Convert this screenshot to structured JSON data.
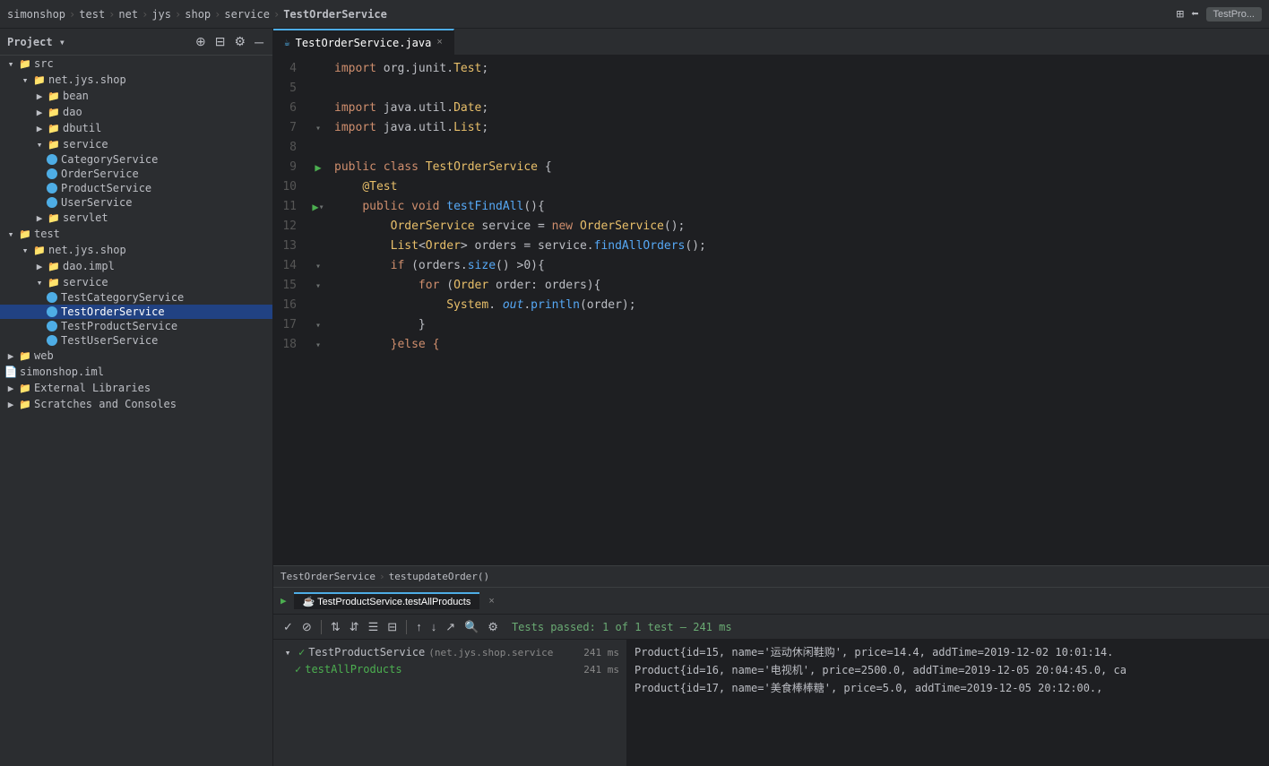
{
  "titleBar": {
    "breadcrumbs": [
      "simonshop",
      "test",
      "net",
      "jys",
      "shop",
      "service",
      "TestOrderService"
    ],
    "rightBtn": "TestPro..."
  },
  "sidebar": {
    "title": "Project",
    "tree": [
      {
        "id": "src",
        "label": "src",
        "type": "folder",
        "indent": 0,
        "expanded": true
      },
      {
        "id": "net.jys.shop",
        "label": "net.jys.shop",
        "type": "folder",
        "indent": 1,
        "expanded": true
      },
      {
        "id": "bean",
        "label": "bean",
        "type": "folder",
        "indent": 2,
        "expanded": false
      },
      {
        "id": "dao",
        "label": "dao",
        "type": "folder",
        "indent": 2,
        "expanded": false
      },
      {
        "id": "dbutil",
        "label": "dbutil",
        "type": "folder",
        "indent": 2,
        "expanded": false
      },
      {
        "id": "service",
        "label": "service",
        "type": "folder",
        "indent": 2,
        "expanded": true
      },
      {
        "id": "CategoryService",
        "label": "CategoryService",
        "type": "java",
        "indent": 3
      },
      {
        "id": "OrderService",
        "label": "OrderService",
        "type": "java",
        "indent": 3
      },
      {
        "id": "ProductService",
        "label": "ProductService",
        "type": "java",
        "indent": 3
      },
      {
        "id": "UserService",
        "label": "UserService",
        "type": "java",
        "indent": 3
      },
      {
        "id": "servlet",
        "label": "servlet",
        "type": "folder",
        "indent": 2,
        "expanded": false
      },
      {
        "id": "test",
        "label": "test",
        "type": "folder",
        "indent": 0,
        "expanded": true
      },
      {
        "id": "net.jys.shop2",
        "label": "net.jys.shop",
        "type": "folder",
        "indent": 1,
        "expanded": true
      },
      {
        "id": "dao.impl",
        "label": "dao.impl",
        "type": "folder",
        "indent": 2,
        "expanded": false
      },
      {
        "id": "service2",
        "label": "service",
        "type": "folder",
        "indent": 2,
        "expanded": true
      },
      {
        "id": "TestCategoryService",
        "label": "TestCategoryService",
        "type": "java",
        "indent": 3
      },
      {
        "id": "TestOrderService",
        "label": "TestOrderService",
        "type": "java",
        "indent": 3,
        "selected": true
      },
      {
        "id": "TestProductService",
        "label": "TestProductService",
        "type": "java",
        "indent": 3
      },
      {
        "id": "TestUserService",
        "label": "TestUserService",
        "type": "java",
        "indent": 3
      },
      {
        "id": "web",
        "label": "web",
        "type": "folder",
        "indent": 0,
        "expanded": false
      },
      {
        "id": "simonshop.iml",
        "label": "simonshop.iml",
        "type": "iml",
        "indent": 0
      },
      {
        "id": "External Libraries",
        "label": "External Libraries",
        "type": "folder",
        "indent": 0,
        "expanded": false
      },
      {
        "id": "Scratches and Consoles",
        "label": "Scratches and Consoles",
        "type": "folder",
        "indent": 0,
        "expanded": false
      }
    ]
  },
  "editor": {
    "tab": "TestOrderService.java",
    "lines": [
      {
        "num": 4,
        "tokens": [
          {
            "t": "import ",
            "c": "import-kw"
          },
          {
            "t": "org.",
            "c": "plain"
          },
          {
            "t": "junit.",
            "c": "plain"
          },
          {
            "t": "Test",
            "c": "import-cls"
          },
          {
            "t": ";",
            "c": "plain"
          }
        ]
      },
      {
        "num": 5,
        "tokens": []
      },
      {
        "num": 6,
        "tokens": [
          {
            "t": "import ",
            "c": "import-kw"
          },
          {
            "t": "java.",
            "c": "plain"
          },
          {
            "t": "util.",
            "c": "plain"
          },
          {
            "t": "Date",
            "c": "import-cls"
          },
          {
            "t": ";",
            "c": "plain"
          }
        ]
      },
      {
        "num": 7,
        "tokens": [
          {
            "t": "import ",
            "c": "import-kw"
          },
          {
            "t": "java.",
            "c": "plain"
          },
          {
            "t": "util.",
            "c": "plain"
          },
          {
            "t": "List",
            "c": "import-cls"
          },
          {
            "t": ";",
            "c": "plain"
          }
        ],
        "fold": true
      },
      {
        "num": 8,
        "tokens": []
      },
      {
        "num": 9,
        "tokens": [
          {
            "t": "public ",
            "c": "kw"
          },
          {
            "t": "class ",
            "c": "kw"
          },
          {
            "t": "TestOrderService",
            "c": "cls"
          },
          {
            "t": " {",
            "c": "plain"
          }
        ],
        "run": true
      },
      {
        "num": 10,
        "tokens": [
          {
            "t": "    ",
            "c": "plain"
          },
          {
            "t": "@Test",
            "c": "ann"
          }
        ]
      },
      {
        "num": 11,
        "tokens": [
          {
            "t": "    ",
            "c": "plain"
          },
          {
            "t": "public ",
            "c": "kw"
          },
          {
            "t": "void ",
            "c": "kw"
          },
          {
            "t": "testFindAll",
            "c": "method"
          },
          {
            "t": "(){",
            "c": "plain"
          }
        ],
        "run": true,
        "fold": true
      },
      {
        "num": 12,
        "tokens": [
          {
            "t": "        ",
            "c": "plain"
          },
          {
            "t": "OrderService",
            "c": "cls"
          },
          {
            "t": " service = ",
            "c": "plain"
          },
          {
            "t": "new ",
            "c": "kw"
          },
          {
            "t": "OrderService",
            "c": "cls"
          },
          {
            "t": "();",
            "c": "plain"
          }
        ]
      },
      {
        "num": 13,
        "tokens": [
          {
            "t": "        ",
            "c": "plain"
          },
          {
            "t": "List",
            "c": "cls"
          },
          {
            "t": "<",
            "c": "plain"
          },
          {
            "t": "Order",
            "c": "cls"
          },
          {
            "t": "> orders = service.",
            "c": "plain"
          },
          {
            "t": "findAllOrders",
            "c": "method"
          },
          {
            "t": "();",
            "c": "plain"
          }
        ]
      },
      {
        "num": 14,
        "tokens": [
          {
            "t": "        ",
            "c": "plain"
          },
          {
            "t": "if",
            "c": "kw"
          },
          {
            "t": " (orders.",
            "c": "plain"
          },
          {
            "t": "size",
            "c": "method"
          },
          {
            "t": "() >0){",
            "c": "plain"
          }
        ],
        "fold": true
      },
      {
        "num": 15,
        "tokens": [
          {
            "t": "            ",
            "c": "plain"
          },
          {
            "t": "for",
            "c": "kw"
          },
          {
            "t": " (",
            "c": "plain"
          },
          {
            "t": "Order",
            "c": "cls"
          },
          {
            "t": " order: orders){",
            "c": "plain"
          }
        ],
        "fold": true
      },
      {
        "num": 16,
        "tokens": [
          {
            "t": "                ",
            "c": "plain"
          },
          {
            "t": "System",
            "c": "cls"
          },
          {
            "t": ". ",
            "c": "plain"
          },
          {
            "t": "out",
            "c": "italic-out"
          },
          {
            "t": ".",
            "c": "plain"
          },
          {
            "t": "println",
            "c": "method"
          },
          {
            "t": "(order);",
            "c": "plain"
          }
        ]
      },
      {
        "num": 17,
        "tokens": [
          {
            "t": "            ",
            "c": "plain"
          },
          {
            "t": "}",
            "c": "plain"
          }
        ],
        "fold": true
      },
      {
        "num": 18,
        "tokens": [
          {
            "t": "        ",
            "c": "plain"
          },
          {
            "t": "}",
            "c": "kw"
          },
          {
            "t": "else {",
            "c": "kw"
          }
        ],
        "fold": true
      }
    ],
    "breadcrumb": "TestOrderService  >  testupdateOrder()"
  },
  "bottomPanel": {
    "tab": "TestProductService.testAllProducts",
    "tabClose": "×",
    "statusText": "Tests passed: 1 of 1 test – 241 ms",
    "testTree": [
      {
        "label": "TestProductService",
        "detail": "(net.jys.shop.service",
        "time": "241 ms",
        "pass": true,
        "expanded": true
      },
      {
        "label": "testAllProducts",
        "time": "241 ms",
        "pass": true,
        "indent": true
      }
    ],
    "consoleLines": [
      "Product{id=15, name='运动休闲鞋购', price=14.4, addTime=2019-12-02 10:01:14.",
      "Product{id=16, name='电视机', price=2500.0, addTime=2019-12-05 20:04:45.0, ca",
      "Product{id=17, name='美食棒棒糖', price=5.0, addTime=2019-12-05 20:12:00.,"
    ]
  }
}
